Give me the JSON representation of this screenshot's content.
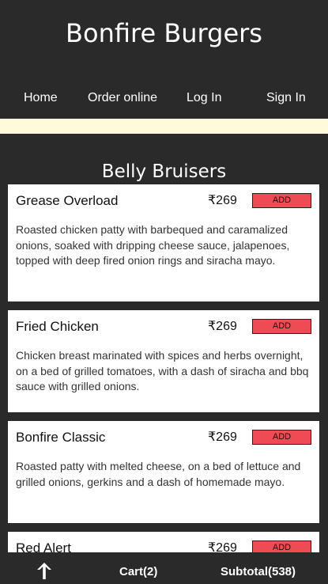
{
  "brand": "Bonfire Burgers",
  "nav": {
    "home": "Home",
    "order_online": "Order online",
    "log_in": "Log In",
    "sign_in": "Sign In"
  },
  "section_title": "Belly Bruisers",
  "items": [
    {
      "name": "Grease Overload",
      "price": "₹269",
      "add_label": "ADD",
      "description": "Roasted chicken patty with barbequed and caramalized onions, soaked with dripping cheese sauce, jalapenoes, topped with deep fired onion rings and siracha mayo."
    },
    {
      "name": "Fried Chicken",
      "price": "₹269",
      "add_label": "ADD",
      "description": "Chicken breast marinated with spices and herbs overnight, on a bed of grilled tomatoes, with a dash of siracha and bbq sauce with grilled onions."
    },
    {
      "name": "Bonfire Classic",
      "price": "₹269",
      "add_label": "ADD",
      "description": "Roasted patty with melted cheese, on a bed of lettuce and grilled onions, gerkins and a dash of homemade mayo."
    },
    {
      "name": "Red Alert",
      "price": "₹269",
      "add_label": "ADD",
      "description": ""
    }
  ],
  "bottom_bar": {
    "up_icon": "arrow-up-icon",
    "cart": "Cart(2)",
    "subtotal": "Subtotal(538)"
  },
  "colors": {
    "background": "#2a2a2a",
    "banner": "#fffad9",
    "add_button": "#ee4b55",
    "card": "#ffffff"
  }
}
